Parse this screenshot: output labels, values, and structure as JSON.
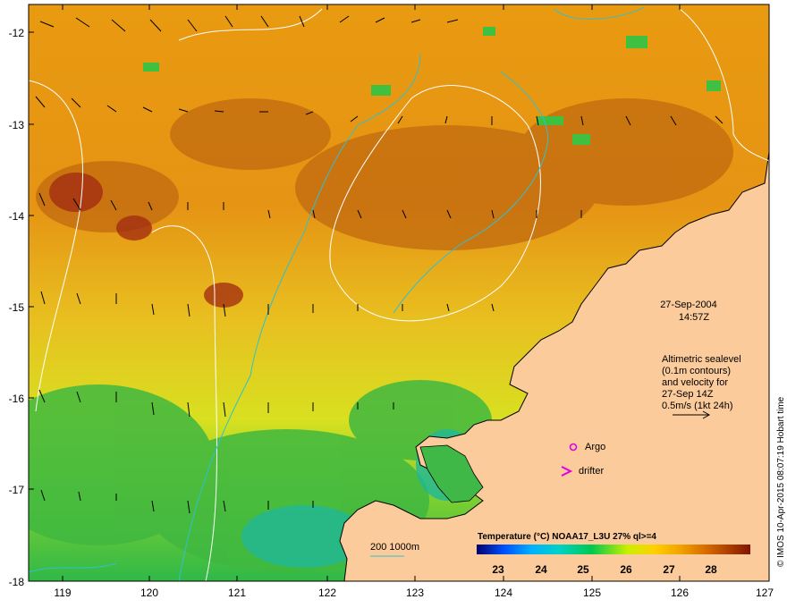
{
  "axes": {
    "lon_ticks": [
      "119",
      "120",
      "121",
      "122",
      "123",
      "124",
      "125",
      "126",
      "127"
    ],
    "lat_ticks": [
      "-12",
      "-13",
      "-14",
      "-15",
      "-16",
      "-17",
      "-18"
    ]
  },
  "date": "27-Sep-2004",
  "time": "14:57Z",
  "altimetry_note": {
    "line1": "Altimetric sealevel",
    "line2": "(0.1m contours)",
    "line3": "and velocity for",
    "line4": "27-Sep 14Z",
    "line5": "0.5m/s (1kt 24h)"
  },
  "legend_markers": {
    "argo": "Argo",
    "drifter": "drifter"
  },
  "bathymetry_label": "200  1000m",
  "colorbar": {
    "title": "Temperature (°C) NOAA17_L3U 27% ql>=4",
    "ticks": [
      "23",
      "24",
      "25",
      "26",
      "27",
      "28"
    ],
    "colors": [
      "#00006e",
      "#0000c8",
      "#0050ff",
      "#00a0ff",
      "#00d2c8",
      "#00c850",
      "#50dc00",
      "#c8f000",
      "#f0f000",
      "#ffc800",
      "#f0a000",
      "#e68200",
      "#d26400",
      "#be4600",
      "#a02800",
      "#821400"
    ]
  },
  "credit": "© IMOS 10-Apr-2015 08:07:19 Hobart time",
  "colors": {
    "land": "#fbcb9b",
    "sst_warm": "#d87a10",
    "sst_mid": "#e8d020",
    "sst_cool": "#40c040",
    "contour": "#ffffff",
    "isobath": "#30c0d0",
    "marker": "#e000e0"
  }
}
